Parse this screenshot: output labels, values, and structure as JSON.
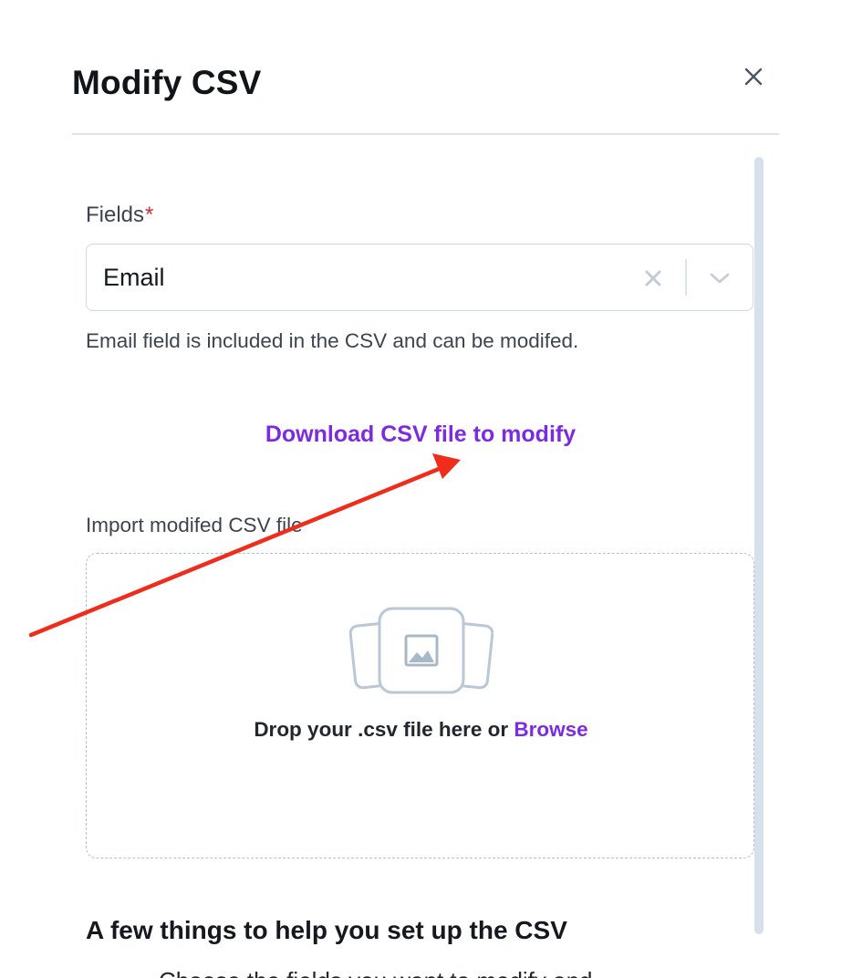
{
  "modal": {
    "title": "Modify CSV",
    "close_icon": "close-icon"
  },
  "fields": {
    "label": "Fields",
    "required_marker": "*",
    "selected_value": "Email",
    "clear_icon": "clear-x-icon",
    "dropdown_icon": "chevron-down-icon",
    "helper_text": "Email field is included in the CSV and can be modifed."
  },
  "download": {
    "link_label": "Download CSV file to modify"
  },
  "import": {
    "label": "Import modifed CSV file",
    "dropzone_icon": "image-upload-icon",
    "drop_text": "Drop your .csv file here or ",
    "browse_label": "Browse"
  },
  "help": {
    "heading": "A few things to help you set up the CSV",
    "first_item_partial": "Choose the fields you want to modify and"
  },
  "colors": {
    "accent": "#7c2be0",
    "required": "#e1243c",
    "annotation_arrow": "#f02d1c"
  }
}
